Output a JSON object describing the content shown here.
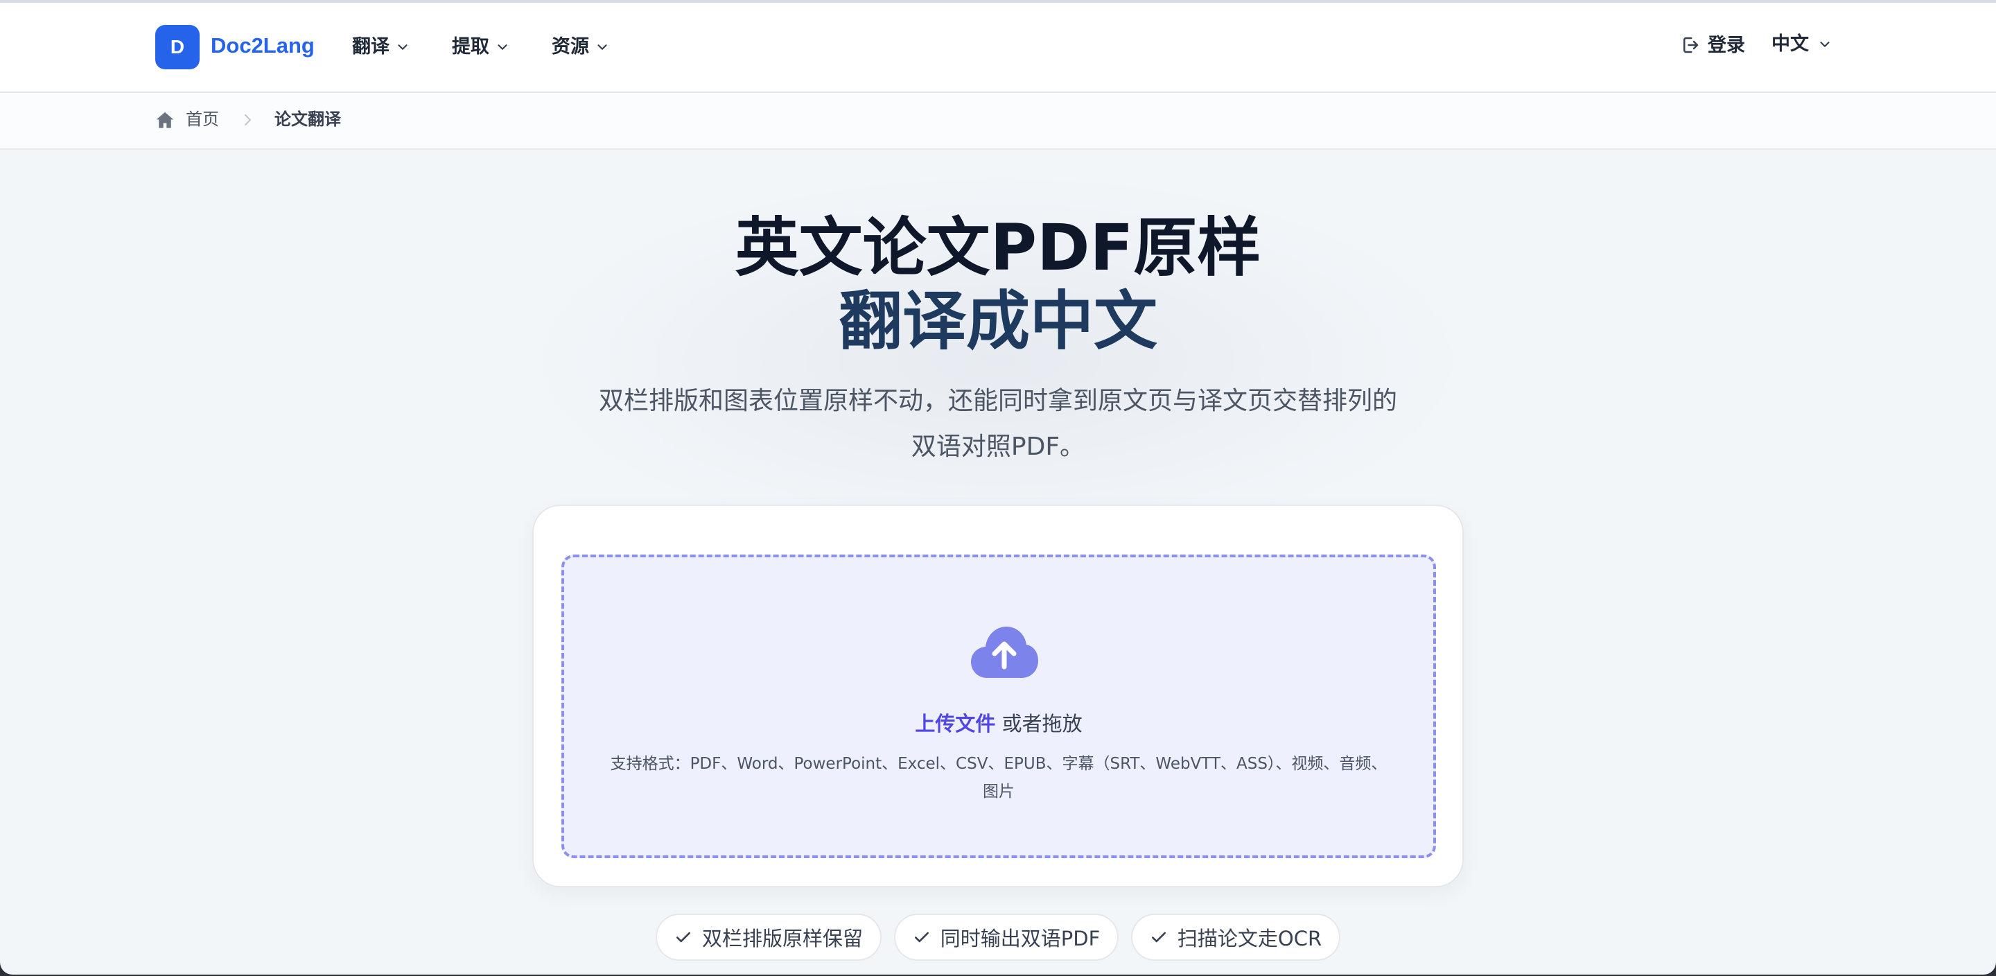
{
  "header": {
    "logo_letter": "D",
    "logo_text": "Doc2Lang",
    "nav": [
      {
        "label": "翻译"
      },
      {
        "label": "提取"
      },
      {
        "label": "资源"
      }
    ],
    "login_label": "登录",
    "language_label": "中文"
  },
  "breadcrumb": {
    "home": "首页",
    "current": "论文翻译"
  },
  "hero": {
    "title_line1": "英文论文PDF原样",
    "title_line2": "翻译成中文",
    "subtitle_line1": "双栏排版和图表位置原样不动，还能同时拿到原文页与译文页交替排列的",
    "subtitle_line2": "双语对照PDF。"
  },
  "upload": {
    "link_label": "上传文件",
    "or_label": "或者拖放",
    "formats_line1": "支持格式：PDF、Word、PowerPoint、Excel、CSV、EPUB、字幕（SRT、WebVTT、ASS）、视频、音频、",
    "formats_line2": "图片"
  },
  "features": [
    {
      "label": "双栏排版原样保留"
    },
    {
      "label": "同时输出双语PDF"
    },
    {
      "label": "扫描论文走OCR"
    }
  ],
  "colors": {
    "brand": "#2563eb",
    "accent": "#4f46e5",
    "dropzone_bg": "#eef0fd",
    "dropzone_border": "#8b8ff0",
    "title_dark": "#0f172a",
    "title_navy": "#1e3a5f"
  },
  "icons": {
    "login": "login-icon",
    "chevron": "chevron-down-icon",
    "home": "home-icon",
    "separator": "chevron-right-icon",
    "upload": "cloud-upload-icon",
    "check": "check-icon"
  }
}
